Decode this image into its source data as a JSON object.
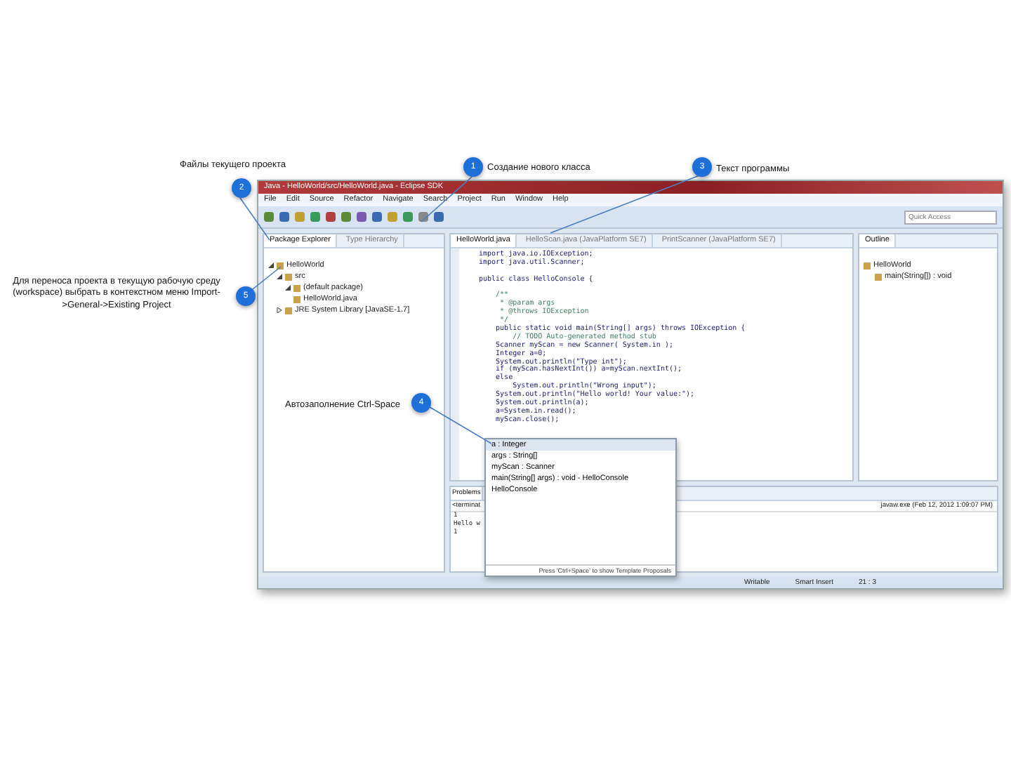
{
  "annotations": [
    {
      "number": "2",
      "text": "Файлы текущего проекта"
    },
    {
      "number": "1",
      "text": "Создание нового класса"
    },
    {
      "number": "3",
      "text": "Текст программы"
    },
    {
      "number": "5",
      "text": "Для переноса проекта в текущую рабочую среду (workspace) выбрать в контекстном меню Import->General->Existing Project"
    },
    {
      "number": "4",
      "text": "Автозаполнение Ctrl-Space"
    }
  ],
  "window": {
    "title": "Java - HelloWorld/src/HelloWorld.java - Eclipse SDK",
    "menu": [
      "File",
      "Edit",
      "Source",
      "Refactor",
      "Navigate",
      "Search",
      "Project",
      "Run",
      "Window",
      "Help"
    ],
    "quick_access": {
      "placeholder": "Quick Access"
    },
    "package_explorer": {
      "tabs": [
        {
          "label": "Package Explorer",
          "selected": true
        },
        {
          "label": "Type Hierarchy",
          "selected": false
        }
      ],
      "tree": [
        {
          "label": "HelloWorld",
          "expanded": true,
          "children": [
            {
              "label": "src",
              "expanded": true,
              "children": [
                {
                  "label": "(default package)",
                  "expanded": true,
                  "children": [
                    {
                      "label": "HelloWorld.java"
                    }
                  ]
                }
              ]
            },
            {
              "label": "JRE System Library [JavaSE-1.7]",
              "expanded": false
            }
          ]
        }
      ]
    },
    "editor": {
      "tabs": [
        {
          "label": "HelloWorld.java",
          "selected": true
        },
        {
          "label": "HelloScan.java (JavaPlatform SE7)",
          "selected": false
        },
        {
          "label": "PrintScanner (JavaPlatform SE7)",
          "selected": false
        }
      ],
      "lines": [
        {
          "kind": "code",
          "text": "import java.io.IOException;"
        },
        {
          "kind": "code",
          "text": "import java.util.Scanner;"
        },
        {
          "kind": "blank"
        },
        {
          "kind": "code",
          "text": "public class HelloConsole {"
        },
        {
          "kind": "blank"
        },
        {
          "kind": "comment",
          "text": "    /**"
        },
        {
          "kind": "comment",
          "text": "     * @param args"
        },
        {
          "kind": "comment",
          "text": "     * @throws IOException"
        },
        {
          "kind": "comment",
          "text": "     */"
        },
        {
          "kind": "code",
          "text": "    public static void main(String[] args) throws IOException {"
        },
        {
          "kind": "comment",
          "text": "        // TODO Auto-generated method stub"
        },
        {
          "kind": "code",
          "text": "    Scanner myScan = new Scanner( System.in );"
        },
        {
          "kind": "code",
          "text": "    Integer a=0;"
        },
        {
          "kind": "code",
          "text": "    System.out.println(\"Type int\");"
        },
        {
          "kind": "code",
          "text": "    if (myScan.hasNextInt()) a=myScan.nextInt();"
        },
        {
          "kind": "code",
          "text": "    else"
        },
        {
          "kind": "code",
          "text": "        System.out.println(\"Wrong input\");"
        },
        {
          "kind": "code",
          "text": "    System.out.println(\"Hello world! Your value:\");"
        },
        {
          "kind": "code",
          "text": "    System.out.println(a);"
        },
        {
          "kind": "code",
          "text": "    a=System.in.read();"
        },
        {
          "kind": "code",
          "text": "    myScan.close();"
        }
      ]
    },
    "completion": {
      "items": [
        {
          "label": "a : Integer",
          "selected": true
        },
        {
          "label": "args : String[]",
          "selected": false
        },
        {
          "label": "myScan : Scanner",
          "selected": false
        },
        {
          "label": "main(String[] args) : void - HelloConsole",
          "selected": false
        },
        {
          "label": "HelloConsole",
          "selected": false
        }
      ],
      "footer": "Press 'Ctrl+Space' to show Template Proposals"
    },
    "outline": {
      "tab": "Outline",
      "tree": [
        {
          "label": "HelloWorld",
          "children": [
            {
              "label": "main(String[]) : void"
            }
          ]
        }
      ]
    },
    "console": {
      "tab": "Problems",
      "header_start": "<terminat",
      "header_end": "javaw.exe (Feb 12, 2012 1:09:07 PM)",
      "lines": [
        "1",
        "Hello w",
        "1"
      ]
    },
    "status_bar": [
      "Writable",
      "Smart Insert",
      "21 : 3"
    ]
  }
}
